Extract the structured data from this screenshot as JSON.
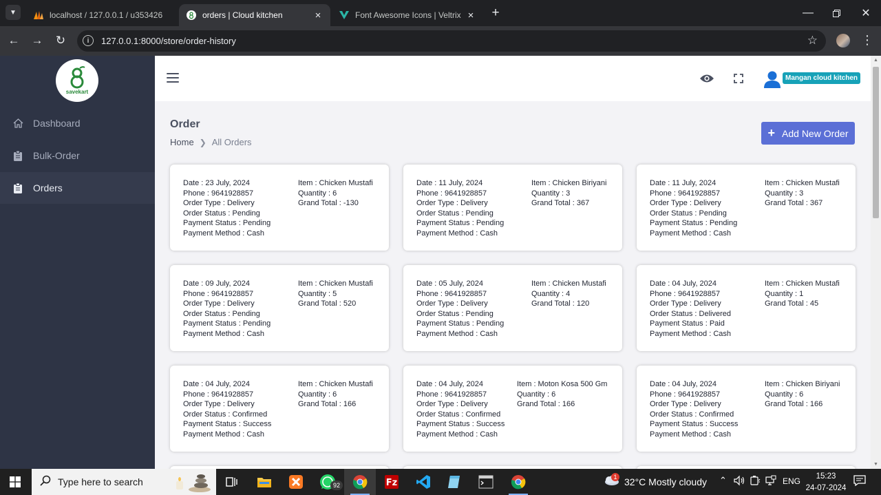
{
  "browser": {
    "tabs": [
      {
        "title": "localhost / 127.0.0.1 / u353426",
        "active": false
      },
      {
        "title": "orders | Cloud kitchen",
        "active": true
      },
      {
        "title": "Font Awesome Icons | Veltrix - A",
        "active": false
      }
    ],
    "url": "127.0.0.1:8000/store/order-history"
  },
  "sidebar": {
    "logo_text": "savekart",
    "items": [
      {
        "label": "Dashboard",
        "icon": "home-icon"
      },
      {
        "label": "Bulk-Order",
        "icon": "clipboard-icon"
      },
      {
        "label": "Orders",
        "icon": "clipboard-icon",
        "active": true
      }
    ]
  },
  "header": {
    "store_name": "Mangan cloud kitchen",
    "badge_color": "#17a2b8"
  },
  "page": {
    "title": "Order",
    "breadcrumb": {
      "home": "Home",
      "current": "All Orders"
    },
    "add_button": "Add New Order",
    "accent_color": "#5b6fd6"
  },
  "orders": [
    {
      "date": "Date : 23 July, 2024",
      "phone": "Phone : 9641928857",
      "type": "Order Type : Delivery",
      "status": "Order Status : Pending",
      "payment_status": "Payment Status : Pending",
      "payment_method": "Payment Method : Cash",
      "item": "Item : Chicken Mustafi",
      "quantity": "Quantity : 6",
      "total": "Grand Total : -130"
    },
    {
      "date": "Date : 11 July, 2024",
      "phone": "Phone : 9641928857",
      "type": "Order Type : Delivery",
      "status": "Order Status : Pending",
      "payment_status": "Payment Status : Pending",
      "payment_method": "Payment Method : Cash",
      "item": "Item : Chicken Biriyani",
      "quantity": "Quantity : 3",
      "total": "Grand Total : 367"
    },
    {
      "date": "Date : 11 July, 2024",
      "phone": "Phone : 9641928857",
      "type": "Order Type : Delivery",
      "status": "Order Status : Pending",
      "payment_status": "Payment Status : Pending",
      "payment_method": "Payment Method : Cash",
      "item": "Item : Chicken Mustafi",
      "quantity": "Quantity : 3",
      "total": "Grand Total : 367"
    },
    {
      "date": "Date : 09 July, 2024",
      "phone": "Phone : 9641928857",
      "type": "Order Type : Delivery",
      "status": "Order Status : Pending",
      "payment_status": "Payment Status : Pending",
      "payment_method": "Payment Method : Cash",
      "item": "Item : Chicken Mustafi",
      "quantity": "Quantity : 5",
      "total": "Grand Total : 520"
    },
    {
      "date": "Date : 05 July, 2024",
      "phone": "Phone : 9641928857",
      "type": "Order Type : Delivery",
      "status": "Order Status : Pending",
      "payment_status": "Payment Status : Pending",
      "payment_method": "Payment Method : Cash",
      "item": "Item : Chicken Mustafi",
      "quantity": "Quantity : 4",
      "total": "Grand Total : 120"
    },
    {
      "date": "Date : 04 July, 2024",
      "phone": "Phone : 9641928857",
      "type": "Order Type : Delivery",
      "status": "Order Status : Delivered",
      "payment_status": "Payment Status : Paid",
      "payment_method": "Payment Method : Cash",
      "item": "Item : Chicken Mustafi",
      "quantity": "Quantity : 1",
      "total": "Grand Total : 45"
    },
    {
      "date": "Date : 04 July, 2024",
      "phone": "Phone : 9641928857",
      "type": "Order Type : Delivery",
      "status": "Order Status : Confirmed",
      "payment_status": "Payment Status : Success",
      "payment_method": "Payment Method : Cash",
      "item": "Item : Chicken Mustafi",
      "quantity": "Quantity : 6",
      "total": "Grand Total : 166"
    },
    {
      "date": "Date : 04 July, 2024",
      "phone": "Phone : 9641928857",
      "type": "Order Type : Delivery",
      "status": "Order Status : Confirmed",
      "payment_status": "Payment Status : Success",
      "payment_method": "Payment Method : Cash",
      "item": "Item : Moton Kosa 500 Gm",
      "quantity": "Quantity : 6",
      "total": "Grand Total : 166"
    },
    {
      "date": "Date : 04 July, 2024",
      "phone": "Phone : 9641928857",
      "type": "Order Type : Delivery",
      "status": "Order Status : Confirmed",
      "payment_status": "Payment Status : Success",
      "payment_method": "Payment Method : Cash",
      "item": "Item : Chicken Biriyani",
      "quantity": "Quantity : 6",
      "total": "Grand Total : 166"
    }
  ],
  "taskbar": {
    "search_placeholder": "Type here to search",
    "whatsapp_badge": "92",
    "weather_alert": "1",
    "weather": "32°C  Mostly cloudy",
    "language": "ENG",
    "time": "15:23",
    "date": "24-07-2024"
  }
}
